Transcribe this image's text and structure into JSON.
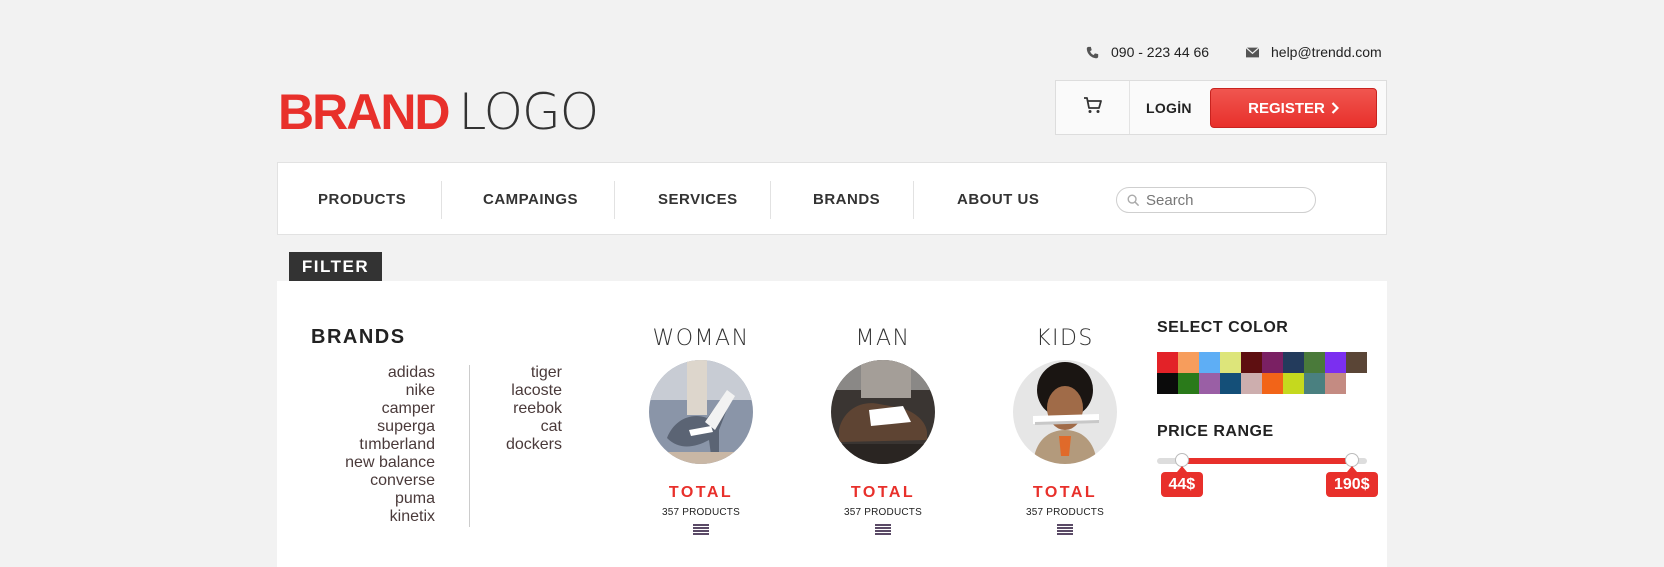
{
  "header": {
    "phone": "090 - 223 44 66",
    "email": "help@trendd.com",
    "logo_bold": "BRAND",
    "logo_light": "LOGO",
    "login_label": "LOGİN",
    "register_label": "REGISTER"
  },
  "nav": {
    "items": [
      {
        "label": "PRODUCTS"
      },
      {
        "label": "CAMPAINGS"
      },
      {
        "label": "SERVICES"
      },
      {
        "label": "BRANDS"
      },
      {
        "label": "ABOUT US"
      }
    ],
    "search_placeholder": "Search"
  },
  "filter": {
    "tab_label": "FILTER",
    "brands_title": "BRANDS",
    "brands_col1": [
      "adidas",
      "nike",
      "camper",
      "superga",
      "tımberland",
      "new balance",
      "converse",
      "puma",
      "kinetix"
    ],
    "brands_col2": [
      "tiger",
      "lacoste",
      "reebok",
      "cat",
      "dockers"
    ],
    "categories": [
      {
        "name": "WOMAN",
        "total_label": "TOTAL",
        "count": "357 PRODUCTS",
        "image": "woman-shoe-photo"
      },
      {
        "name": "MAN",
        "total_label": "TOTAL",
        "count": "357 PRODUCTS",
        "image": "man-shoe-photo"
      },
      {
        "name": "KIDS",
        "total_label": "TOTAL",
        "count": "357 PRODUCTS",
        "image": "kid-shoe-photo"
      }
    ],
    "color_title": "SELECT COLOR",
    "colors": [
      "#e32228",
      "#f79d5c",
      "#5eaef5",
      "#dde57a",
      "#5e0f11",
      "#7a2063",
      "#233b5c",
      "#4a7a3a",
      "#7b2ff0",
      "#5a4536",
      "#0b0b0b",
      "#2a7a1a",
      "#9a5fa5",
      "#144f78",
      "#cdaeae",
      "#f26418",
      "#c5d91e",
      "#4a8080",
      "#c48b82"
    ],
    "price_title": "PRICE RANGE",
    "price_min": "44$",
    "price_max": "190$",
    "price_min_fraction": 0.12,
    "price_max_fraction": 0.93
  }
}
